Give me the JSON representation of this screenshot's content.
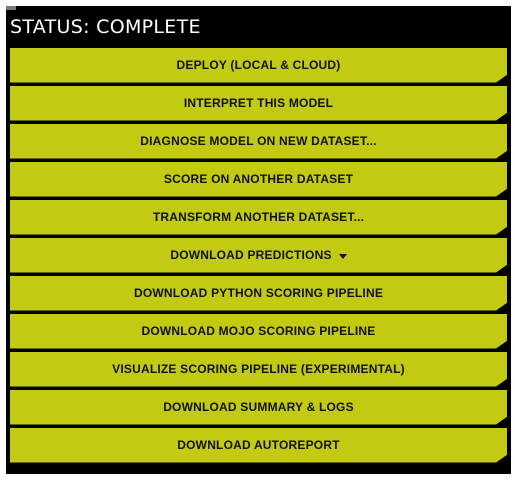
{
  "status": {
    "text": "STATUS: COMPLETE"
  },
  "actions": [
    {
      "label": "DEPLOY (LOCAL & CLOUD)"
    },
    {
      "label": "INTERPRET THIS MODEL"
    },
    {
      "label": "DIAGNOSE MODEL ON NEW DATASET..."
    },
    {
      "label": "SCORE ON ANOTHER DATASET"
    },
    {
      "label": "TRANSFORM ANOTHER DATASET..."
    },
    {
      "label": "DOWNLOAD PREDICTIONS",
      "icon": "caret-down-icon"
    },
    {
      "label": "DOWNLOAD PYTHON SCORING PIPELINE"
    },
    {
      "label": "DOWNLOAD MOJO SCORING PIPELINE"
    },
    {
      "label": "VISUALIZE SCORING PIPELINE (EXPERIMENTAL)"
    },
    {
      "label": "DOWNLOAD SUMMARY & LOGS"
    },
    {
      "label": "DOWNLOAD AUTOREPORT"
    }
  ],
  "colors": {
    "panel_background": "#000000",
    "button_background": "#c2cb11",
    "button_text": "#111111",
    "status_text": "#ffffff"
  }
}
